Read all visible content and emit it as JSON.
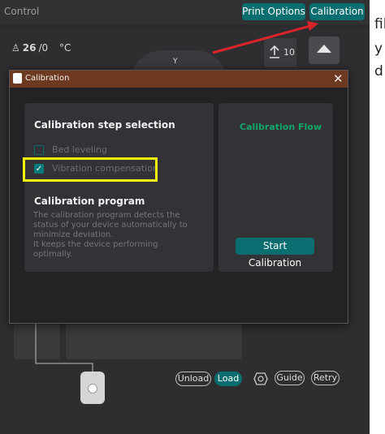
{
  "app": {
    "control_label": "Control",
    "print_options_label": "Print Options",
    "calibration_label": "Calibration",
    "temperature": {
      "current": "26",
      "target": "/0",
      "unit": "°C"
    },
    "y_label": "Y",
    "step_value": "10",
    "unload_label": "Unload",
    "load_label": "Load",
    "guide_label": "Guide",
    "retry_label": "Retry",
    "right_strip_text": [
      "fil",
      "y",
      "d"
    ]
  },
  "dialog": {
    "title": "Calibration",
    "step_selection_heading": "Calibration step selection",
    "options": [
      {
        "label": "Bed leveling",
        "checked": false
      },
      {
        "label": "Vibration compensation",
        "checked": true
      }
    ],
    "program_heading": "Calibration program",
    "program_description": "The calibration program detects the status of your device automatically to minimize deviation.\nIt keeps the device performing optimally.",
    "flow_label": "Calibration Flow",
    "start_button_label": "Start Calibration"
  },
  "colors": {
    "accent_teal": "#0a6d6f",
    "title_bar_brown": "#6e3a1f",
    "flow_green": "#10a86a",
    "highlight_yellow": "#f2f20b",
    "arrow_red": "#d9252a"
  },
  "icons": [
    "person-icon",
    "upload-icon",
    "eject-icon",
    "close-icon",
    "check-icon",
    "app-logo-icon",
    "nozzle-icon",
    "filament-spool-icon"
  ]
}
